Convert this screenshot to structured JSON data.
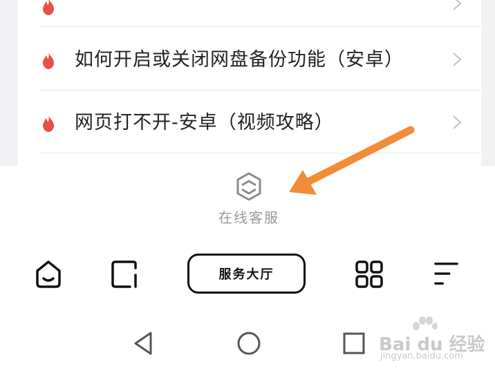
{
  "faq": {
    "items": [
      {
        "label": "如何开启或关闭网盘备份功能（安卓）",
        "icon": "fire-icon",
        "chevron": "chevron-right-icon"
      },
      {
        "label": "网页打不开-安卓（视频攻略）",
        "icon": "fire-icon",
        "chevron": "chevron-right-icon"
      }
    ]
  },
  "support": {
    "label": "在线客服",
    "icon": "customer-service-icon"
  },
  "tabbar": {
    "home_icon": "home-icon",
    "order_icon": "order-icon",
    "service_button_label": "服务大厅",
    "apps_icon": "grid-icon",
    "menu_icon": "menu-icon"
  },
  "system_nav": {
    "back_icon": "back-triangle-icon",
    "home_icon": "home-circle-icon",
    "recents_icon": "recents-square-icon"
  },
  "watermark": {
    "brand": "Bai du 经验",
    "url": "jingyan.baidu.com"
  },
  "colors": {
    "fire": "#e8504a",
    "arrow": "#f28c38",
    "muted_text": "#999999",
    "text": "#222222"
  }
}
